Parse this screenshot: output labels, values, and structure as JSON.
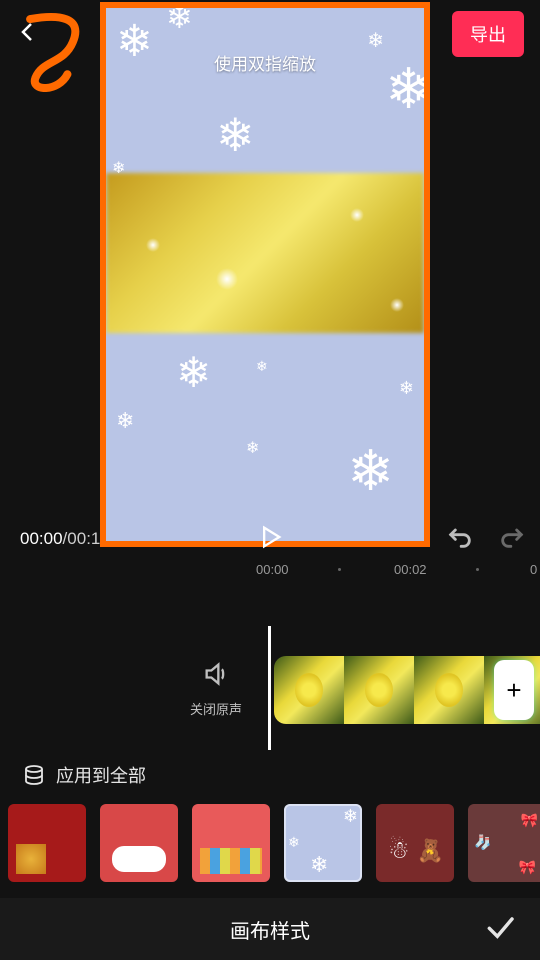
{
  "topbar": {
    "export_label": "导出"
  },
  "preview": {
    "hint": "使用双指缩放"
  },
  "playback": {
    "current": "00:00",
    "sep": "/",
    "total": "00:1"
  },
  "ruler": {
    "t0": "00:00",
    "t1": "00:02",
    "t2": "0"
  },
  "mute": {
    "label": "关闭原声"
  },
  "add_clip": {
    "label": "+"
  },
  "styles": {
    "apply_all_label": "应用到全部",
    "selected_index": 3
  },
  "bottom": {
    "title": "画布样式"
  },
  "colors": {
    "accent": "#ff2d55",
    "frame": "#ff6a00"
  }
}
